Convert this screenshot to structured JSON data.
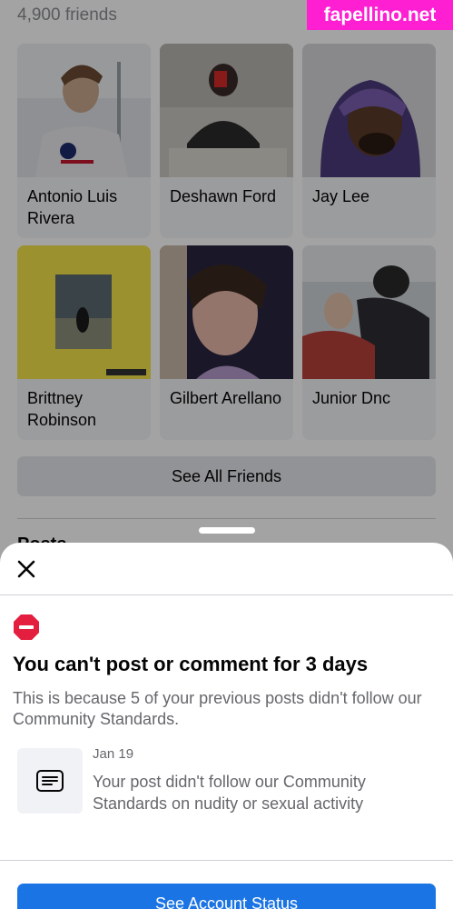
{
  "profile": {
    "friends_count": "4,900 friends",
    "friends": [
      {
        "name": "Antonio Luis Rivera"
      },
      {
        "name": "Deshawn Ford"
      },
      {
        "name": "Jay Lee"
      },
      {
        "name": "Brittney Robinson"
      },
      {
        "name": "Gilbert Arellano"
      },
      {
        "name": "Junior Dnc"
      }
    ],
    "see_all_label": "See All Friends",
    "posts_heading": "Posts"
  },
  "sheet": {
    "close_icon": "close-icon",
    "warning_icon": "stop-sign-icon",
    "title": "You can't post or comment for 3 days",
    "description": "This is because 5 of your previous posts didn't follow our Community Standards.",
    "post": {
      "icon": "post-icon",
      "date": "Jan 19",
      "text": "Your post didn't follow our Community Standards on nudity or sexual activity"
    },
    "button_label": "See Account Status"
  },
  "watermark": "fapellino.net",
  "colors": {
    "accent": "#1b74e4",
    "warning": "#e41e3f",
    "watermark": "#ff1fd3"
  }
}
